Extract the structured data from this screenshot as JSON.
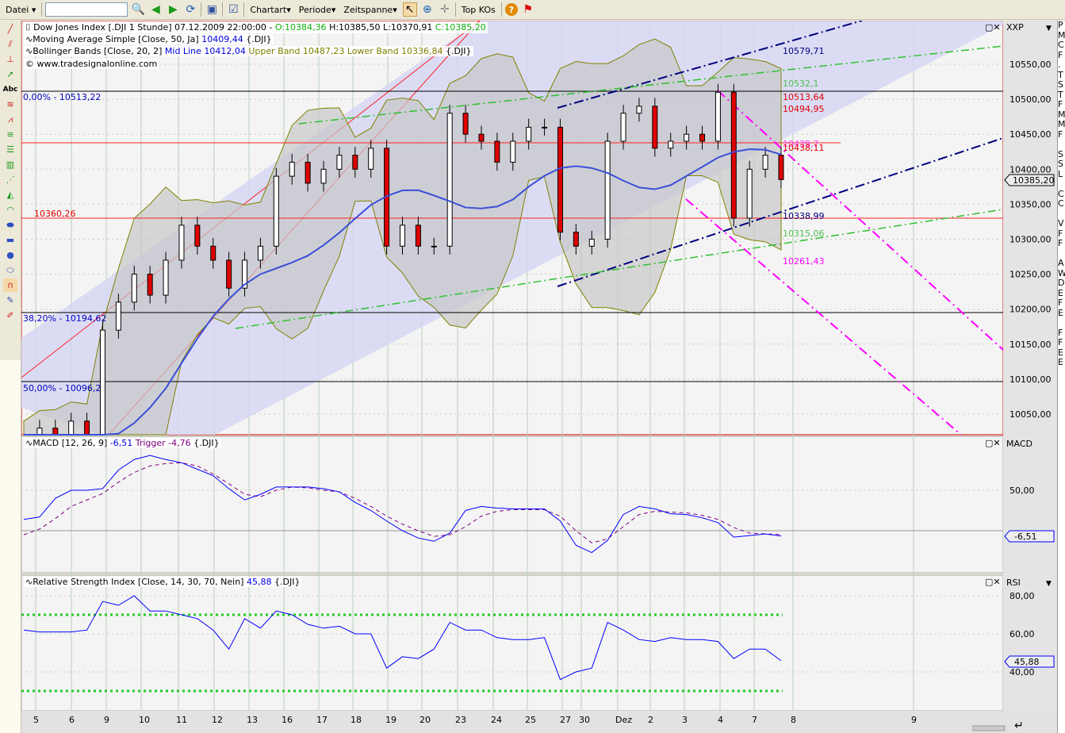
{
  "toolbar": {
    "file": "Datei",
    "search_value": "",
    "charttype": "Chartart",
    "period": "Periode",
    "timespan": "Zeitspanne",
    "topkos": "Top KOs"
  },
  "legend": {
    "main_prefix": "Dow Jones Index [.DJI  1 Stunde] 07.12.2009 22:00:00 - ",
    "open": "O:10384,36",
    "high": "H:10385,50",
    "low": "L:10370,91",
    "close": "C:10385,20",
    "ma_label": "Moving Average Simple [Close, 50, Ja]",
    "ma_value": "10409,44",
    "ma_suffix": "{.DJI}",
    "bb_label": "Bollinger Bands [Close, 20, 2]",
    "bb_mid": "Mid Line 10412,04",
    "bb_upper": "Upper Band 10487,23",
    "bb_lower": "Lower Band 10336,84",
    "bb_suffix": "{.DJI}",
    "copyright": "© www.tradesignalonline.com",
    "macd_label": "MACD [12, 26, 9]",
    "macd_value": "-6,51",
    "macd_trigger": "Trigger -4,76",
    "macd_suffix": "{.DJI}",
    "rsi_label": "Relative Strength Index [Close, 14, 30, 70, Nein]",
    "rsi_value": "45,88",
    "rsi_suffix": "{.DJI}"
  },
  "axes": {
    "price_title": "XXP",
    "price_ticks": [
      "10550,00",
      "10500,00",
      "10450,00",
      "10400,00",
      "10350,00",
      "10300,00",
      "10250,00",
      "10200,00",
      "10150,00",
      "10100,00",
      "10050,00"
    ],
    "last_price": "10385,20",
    "macd_title": "MACD",
    "macd_ticks": [
      "50,00"
    ],
    "macd_last": "-6,51",
    "rsi_title": "RSI",
    "rsi_ticks": [
      "80,00",
      "60,00",
      "40,00"
    ],
    "rsi_last": "45,88",
    "dates": [
      "5",
      "6",
      "9",
      "10",
      "11",
      "12",
      "13",
      "16",
      "17",
      "18",
      "19",
      "20",
      "23",
      "24",
      "25",
      "27",
      "30",
      "Dez",
      "2",
      "3",
      "4",
      "7",
      "8",
      "9"
    ]
  },
  "levels": {
    "fib0": "0,00% - 10513,22",
    "fib382": "38,20% - 10194,62",
    "fib50": "50,00% - 10096,2",
    "support": "10360,26",
    "r1": "10579,71",
    "r2": "10532,1",
    "r3": "10513,64",
    "r4": "10494,95",
    "r5": "10439,7",
    "r6": "10438,11",
    "r7": "10338,99",
    "r8": "10315,06",
    "r9": "10261,43"
  },
  "right_panel_letters": [
    "P",
    "M",
    "C",
    "F",
    ".",
    "T",
    "S",
    "T",
    "F",
    "M",
    "M",
    "F",
    "",
    "S",
    "S",
    "L",
    "",
    "C",
    "C",
    "",
    "V",
    "F",
    "F",
    "",
    "A",
    "W",
    "D",
    "E",
    "F",
    "E",
    "",
    "F",
    "F",
    "E",
    "E"
  ],
  "colors": {
    "up": "#ffffff",
    "down": "#e00000",
    "ma": "#3a4fd8",
    "bb": "#808000",
    "macd": "#0000ff",
    "trigger": "#800080",
    "rsi": "#0000ff",
    "rsi_bands": "#22cc22"
  },
  "chart_data": {
    "type": "line",
    "title": "Dow Jones Index [.DJI 1 Stunde]",
    "price_range": [
      10000,
      10580
    ],
    "closes": [
      10020,
      10030,
      10010,
      10040,
      10020,
      10170,
      10210,
      10250,
      10220,
      10270,
      10320,
      10290,
      10270,
      10230,
      10270,
      10290,
      10390,
      10410,
      10380,
      10400,
      10420,
      10400,
      10430,
      10290,
      10320,
      10290,
      10290,
      10480,
      10450,
      10440,
      10410,
      10440,
      10460,
      10460,
      10310,
      10290,
      10300,
      10440,
      10480,
      10490,
      10430,
      10440,
      10450,
      10440,
      10510,
      10330,
      10400,
      10420,
      10385.2
    ],
    "macd": [
      14,
      17,
      40,
      50,
      50,
      52,
      75,
      88,
      93,
      88,
      84,
      76,
      68,
      52,
      38,
      45,
      54,
      54,
      54,
      52,
      48,
      35,
      25,
      12,
      0,
      -9,
      -13,
      -3,
      25,
      30,
      28,
      27,
      27,
      27,
      12,
      -18,
      -27,
      -12,
      20,
      30,
      27,
      21,
      20,
      16,
      10,
      -8,
      -6,
      -4,
      -6.51
    ],
    "trigger": [
      -5,
      2,
      15,
      30,
      38,
      46,
      60,
      72,
      80,
      83,
      84,
      80,
      70,
      58,
      45,
      42,
      50,
      54,
      53,
      50,
      48,
      40,
      30,
      18,
      8,
      0,
      -7,
      -5,
      5,
      18,
      24,
      26,
      26,
      26,
      18,
      0,
      -15,
      -10,
      5,
      20,
      24,
      23,
      22,
      19,
      14,
      4,
      -3,
      -4,
      -4.76
    ],
    "rsi": [
      62,
      61,
      61,
      61,
      62,
      77,
      75,
      80,
      72,
      72,
      70,
      68,
      62,
      52,
      68,
      63,
      72,
      70,
      65,
      63,
      64,
      60,
      60,
      42,
      48,
      47,
      52,
      66,
      62,
      62,
      58,
      57,
      57,
      58,
      36,
      40,
      42,
      66,
      62,
      57,
      56,
      58,
      57,
      57,
      56,
      47,
      52,
      52,
      45.88
    ],
    "rsi_bands": [
      30,
      70
    ]
  }
}
